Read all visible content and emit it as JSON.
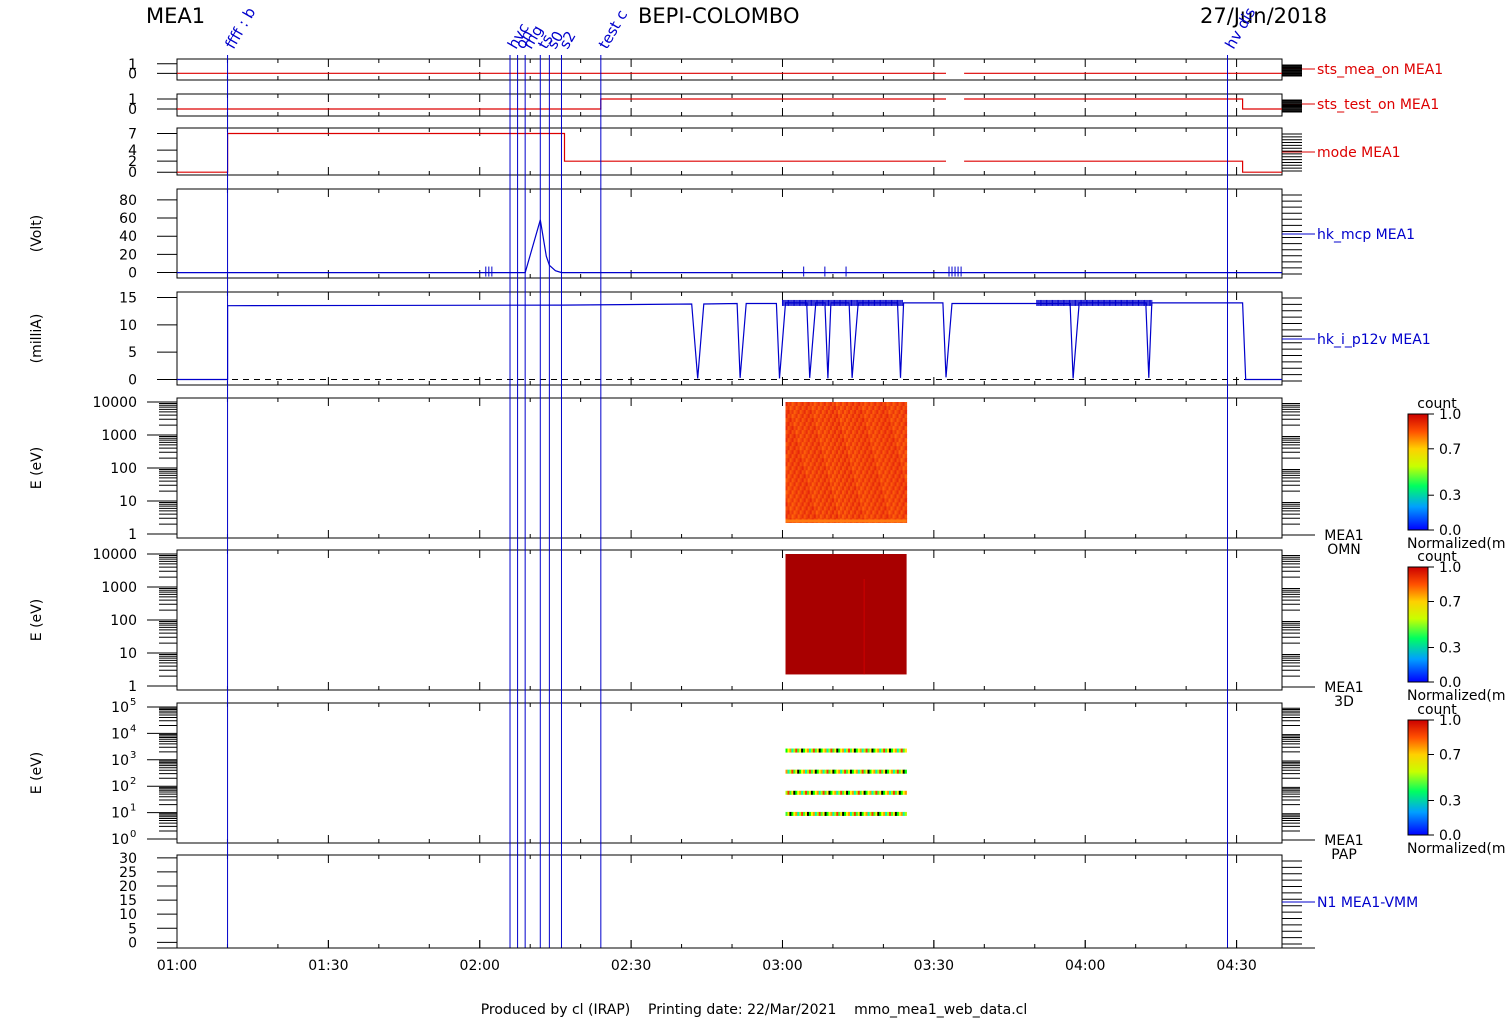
{
  "header": {
    "instrument": "MEA1",
    "mission": "BEPI-COLOMBO",
    "date": "27/Jun/2018"
  },
  "footer": {
    "credit": "Produced by cl (IRAP)    Printing date: 22/Mar/2021    mmo_mea1_web_data.cl"
  },
  "colors": {
    "status_red": "#dd0000",
    "hk_blue": "#0000cc",
    "frame": "#000000"
  },
  "colorbar": {
    "title": "count",
    "ticks": [
      "1.0",
      "0.7",
      "0.3",
      "0.0"
    ],
    "ticks_b": [
      "1.0",
      "0.7",
      "0.3",
      "0.0"
    ],
    "ticks_c": [
      "1.0",
      "0.7",
      "0.3",
      "0.0"
    ],
    "label": "Normalized(m"
  },
  "events": [
    {
      "t": 1.167,
      "label": "ffff : b"
    },
    {
      "t": 2.1,
      "label": "hvc"
    },
    {
      "t": 2.125,
      "label": "on"
    },
    {
      "t": 2.15,
      "label": "mg"
    },
    {
      "t": 2.2,
      "label": "ts"
    },
    {
      "t": 2.23,
      "label": "s0"
    },
    {
      "t": 2.27,
      "label": "s2"
    },
    {
      "t": 2.4,
      "label": "test c"
    },
    {
      "t": 4.47,
      "label": "hv dis"
    }
  ],
  "chart_data": [
    {
      "type": "line",
      "name": "sts_mea_on MEA1",
      "yticks": [
        "1",
        "0"
      ],
      "ylim": [
        -0.7,
        1.5
      ],
      "x_range": [
        1.0,
        4.65
      ],
      "segments": [
        [
          [
            1.0,
            0.0
          ],
          [
            3.54,
            0.0
          ]
        ],
        [
          [
            3.6,
            0.0
          ],
          [
            4.65,
            0.0
          ]
        ]
      ]
    },
    {
      "type": "line",
      "name": "sts_test_on MEA1",
      "yticks": [
        "1",
        "0"
      ],
      "ylim": [
        -0.7,
        1.5
      ],
      "segments": [
        [
          [
            1.0,
            0.0
          ],
          [
            2.4,
            0.0
          ],
          [
            2.4,
            1.0
          ],
          [
            3.54,
            1.0
          ]
        ],
        [
          [
            3.6,
            1.0
          ],
          [
            4.52,
            1.0
          ],
          [
            4.52,
            0.0
          ],
          [
            4.65,
            0.0
          ]
        ]
      ]
    },
    {
      "type": "line",
      "name": "mode MEA1",
      "yticks": [
        "7",
        "4",
        "2",
        "0"
      ],
      "ylim": [
        -0.5,
        8.0
      ],
      "segments": [
        [
          [
            1.0,
            0.0
          ],
          [
            1.167,
            0.0
          ],
          [
            1.167,
            7.0
          ],
          [
            2.28,
            7.0
          ],
          [
            2.28,
            2.0
          ],
          [
            3.54,
            2.0
          ]
        ],
        [
          [
            3.6,
            2.0
          ],
          [
            4.52,
            2.0
          ],
          [
            4.52,
            0.0
          ],
          [
            4.65,
            0.0
          ]
        ]
      ]
    },
    {
      "type": "line",
      "name": "hk_mcp MEA1",
      "ylabel": "(Volt)",
      "yticks": [
        "80",
        "60",
        "40",
        "20",
        "0"
      ],
      "yvals": [
        80,
        60,
        40,
        20,
        0
      ],
      "ylim": [
        -6,
        92
      ],
      "segments": [
        [
          [
            1.0,
            0.0
          ],
          [
            2.15,
            0.0
          ],
          [
            2.2,
            58.0
          ],
          [
            2.21,
            38.0
          ],
          [
            2.22,
            18.0
          ],
          [
            2.23,
            8.0
          ],
          [
            2.25,
            2.0
          ],
          [
            2.27,
            0.0
          ],
          [
            4.65,
            0.0
          ]
        ]
      ],
      "ticks_at": [
        2.02,
        2.03,
        2.04,
        3.07,
        3.14,
        3.21,
        3.55,
        3.56,
        3.57,
        3.58,
        3.59
      ]
    },
    {
      "type": "line",
      "name": "hk_i_p12v MEA1",
      "ylabel": "(milliA)",
      "yticks": [
        "15",
        "10",
        "5",
        "0"
      ],
      "yvals": [
        15,
        10,
        5,
        0
      ],
      "ylim": [
        -1,
        16
      ],
      "segments": [
        [
          [
            1.0,
            0.0
          ],
          [
            1.167,
            0.0
          ],
          [
            1.167,
            13.5
          ],
          [
            2.27,
            13.6
          ],
          [
            2.7,
            13.8
          ],
          [
            2.72,
            0.2
          ],
          [
            2.74,
            13.8
          ],
          [
            2.85,
            13.9
          ],
          [
            2.86,
            0.3
          ],
          [
            2.88,
            13.9
          ],
          [
            2.98,
            13.9
          ],
          [
            2.99,
            0.2
          ],
          [
            3.01,
            14.0
          ],
          [
            3.08,
            14.0
          ],
          [
            3.09,
            0.3
          ],
          [
            3.11,
            14.0
          ],
          [
            3.14,
            14.0
          ],
          [
            3.15,
            0.2
          ],
          [
            3.16,
            14.0
          ],
          [
            3.22,
            14.0
          ],
          [
            3.23,
            0.3
          ],
          [
            3.25,
            14.0
          ],
          [
            3.38,
            14.0
          ],
          [
            3.39,
            0.3
          ],
          [
            3.4,
            14.0
          ],
          [
            3.53,
            14.0
          ],
          [
            3.54,
            0.4
          ],
          [
            3.56,
            13.9
          ],
          [
            3.95,
            13.9
          ],
          [
            3.96,
            0.2
          ],
          [
            3.98,
            14.0
          ],
          [
            4.2,
            14.0
          ],
          [
            4.21,
            0.3
          ],
          [
            4.22,
            14.0
          ],
          [
            4.52,
            14.0
          ],
          [
            4.53,
            0.0
          ],
          [
            4.65,
            0.0
          ]
        ]
      ],
      "dashed_zero": true,
      "noisy_ranges": [
        [
          3.0,
          3.4
        ],
        [
          3.84,
          4.22
        ]
      ]
    },
    {
      "type": "heatmap",
      "name": "MEA1 OMN",
      "label_lines": [
        "MEA1",
        "OMN"
      ],
      "ylabel": "E (eV)",
      "yticks": [
        "10000",
        "1000",
        "100",
        "10",
        "1"
      ],
      "y_log_range": [
        0,
        4
      ],
      "blocks": [
        {
          "t0": 3.01,
          "t1": 3.41,
          "e0_log": 0.35,
          "e1_log": 4.0,
          "value": 0.85
        }
      ]
    },
    {
      "type": "heatmap",
      "name": "MEA1 3D",
      "label_lines": [
        "MEA1",
        "3D"
      ],
      "ylabel": "E (eV)",
      "yticks": [
        "10000",
        "1000",
        "100",
        "10",
        "1"
      ],
      "y_log_range": [
        0,
        4
      ],
      "blocks": [
        {
          "t0": 3.01,
          "t1": 3.41,
          "e0_log": 0.35,
          "e1_log": 4.0,
          "value": 0.97
        }
      ]
    },
    {
      "type": "heatmap",
      "name": "MEA1 PAP",
      "label_lines": [
        "MEA1",
        "PAP"
      ],
      "ylabel": "E (eV)",
      "yticks_base": [
        "10",
        "10",
        "10",
        "10",
        "10",
        "10"
      ],
      "yticks_exp": [
        "5",
        "4",
        "3",
        "2",
        "1",
        "0"
      ],
      "y_log_range": [
        0,
        5
      ],
      "bands_log": [
        3.35,
        2.55,
        1.75,
        0.95
      ],
      "band_t": [
        3.01,
        3.41
      ]
    },
    {
      "type": "line",
      "name": "N1 MEA1-VMM",
      "yticks": [
        "30",
        "25",
        "20",
        "15",
        "10",
        "5",
        "0"
      ],
      "yvals": [
        30,
        25,
        20,
        15,
        10,
        5,
        0
      ],
      "ylim": [
        -2,
        31
      ]
    }
  ],
  "xaxis": {
    "ticks": [
      "01:00",
      "01:30",
      "02:00",
      "02:30",
      "03:00",
      "03:30",
      "04:00",
      "04:30"
    ],
    "tick_hours": [
      1.0,
      1.5,
      2.0,
      2.5,
      3.0,
      3.5,
      4.0,
      4.5
    ],
    "range": [
      1.0,
      4.65
    ]
  }
}
